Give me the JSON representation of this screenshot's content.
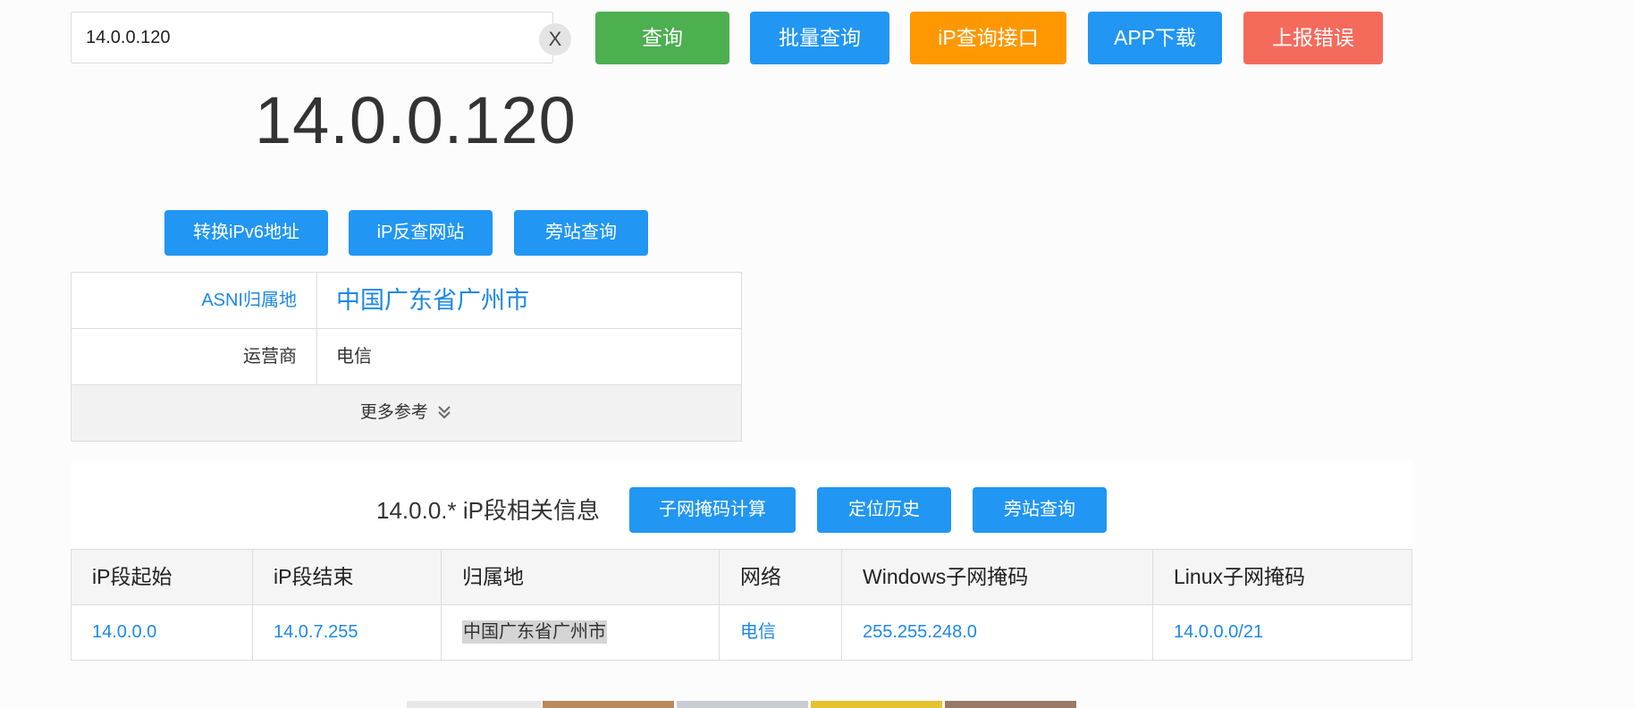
{
  "search": {
    "value": "14.0.0.120",
    "clear_label": "X"
  },
  "top_buttons": {
    "query": "查询",
    "batch": "批量查询",
    "api": "iP查询接口",
    "app": "APP下载",
    "report": "上报错误"
  },
  "ip": "14.0.0.120",
  "action_buttons": {
    "ipv6": "转换iPv6地址",
    "reverse": "iP反查网站",
    "nearby": "旁站查询"
  },
  "info": {
    "asn_label": "ASNI归属地",
    "asn_value": "中国广东省广州市",
    "isp_label": "运营商",
    "isp_value": "电信",
    "more": "更多参考"
  },
  "segment": {
    "title": "14.0.0.* iP段相关信息",
    "buttons": {
      "subnet": "子网掩码计算",
      "history": "定位历史",
      "nearby": "旁站查询"
    },
    "headers": [
      "iP段起始",
      "iP段结束",
      "归属地",
      "网络",
      "Windows子网掩码",
      "Linux子网掩码"
    ],
    "row": {
      "start": "14.0.0.0",
      "end": "14.0.7.255",
      "location": "中国广东省广州市",
      "network": "电信",
      "windows_mask": "255.255.248.0",
      "linux_mask": "14.0.0.0/21"
    }
  },
  "colors": {
    "green": "#4caf50",
    "blue": "#2196f3",
    "orange": "#ff9800",
    "red": "#f46b5c",
    "link": "#1e88e5"
  }
}
